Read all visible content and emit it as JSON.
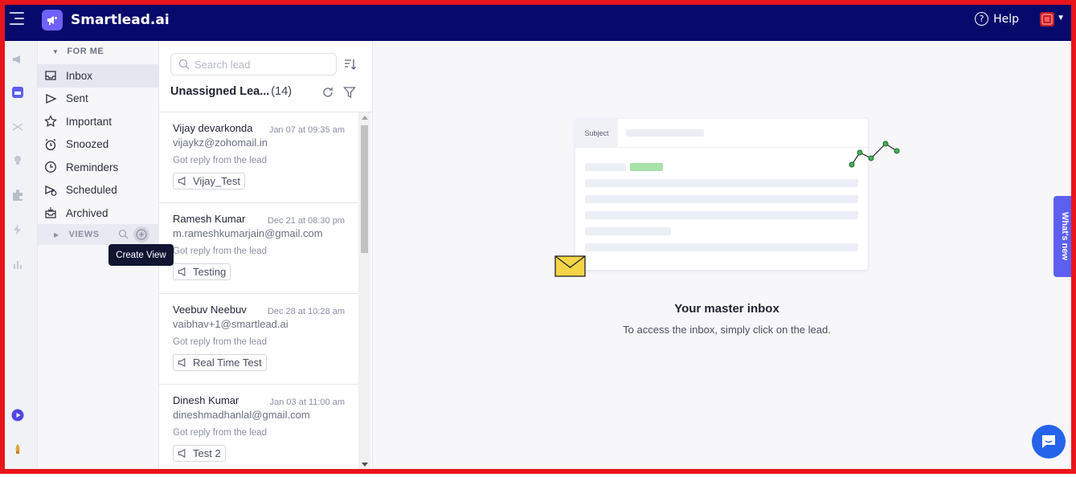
{
  "app": {
    "brand": "Smartlead.ai",
    "help_label": "Help"
  },
  "nav": {
    "section_label": "FOR ME",
    "items": [
      {
        "label": "Inbox",
        "icon": "inbox-icon",
        "active": true
      },
      {
        "label": "Sent",
        "icon": "send-icon"
      },
      {
        "label": "Important",
        "icon": "star-icon"
      },
      {
        "label": "Snoozed",
        "icon": "alarm-clock-icon"
      },
      {
        "label": "Reminders",
        "icon": "clock-icon"
      },
      {
        "label": "Scheduled",
        "icon": "scheduled-send-icon"
      },
      {
        "label": "Archived",
        "icon": "archive-icon"
      }
    ],
    "views_label": "VIEWS",
    "tooltip": "Create View"
  },
  "leads": {
    "search_placeholder": "Search lead",
    "title": "Unassigned Lea...",
    "count": "(14)",
    "items": [
      {
        "name": "Vijay devarkonda",
        "date": "Jan 07 at 09:35 am",
        "email": "vijaykz@zohomail.in",
        "status": "Got reply from the lead",
        "campaign": "Vijay_Test"
      },
      {
        "name": "Ramesh Kumar",
        "date": "Dec 21 at 08:30 pm",
        "email": "m.rameshkumarjain@gmail.com",
        "status": "Got reply from the lead",
        "campaign": "Testing"
      },
      {
        "name": "Veebuv Neebuv",
        "date": "Dec 28 at 10:28 am",
        "email": "vaibhav+1@smartlead.ai",
        "status": "Got reply from the lead",
        "campaign": "Real Time Test"
      },
      {
        "name": "Dinesh Kumar",
        "date": "Jan 03 at 11:00 am",
        "email": "dineshmadhanlal@gmail.com",
        "status": "Got reply from the lead",
        "campaign": "Test 2"
      }
    ]
  },
  "main": {
    "card_subject": "Subject",
    "title": "Your master inbox",
    "subtitle": "To access the inbox, simply click on the lead."
  },
  "whats_new": "What's new",
  "colors": {
    "topbar": "#070a6b",
    "accent": "#5d5ff0",
    "chat": "#2563eb"
  }
}
